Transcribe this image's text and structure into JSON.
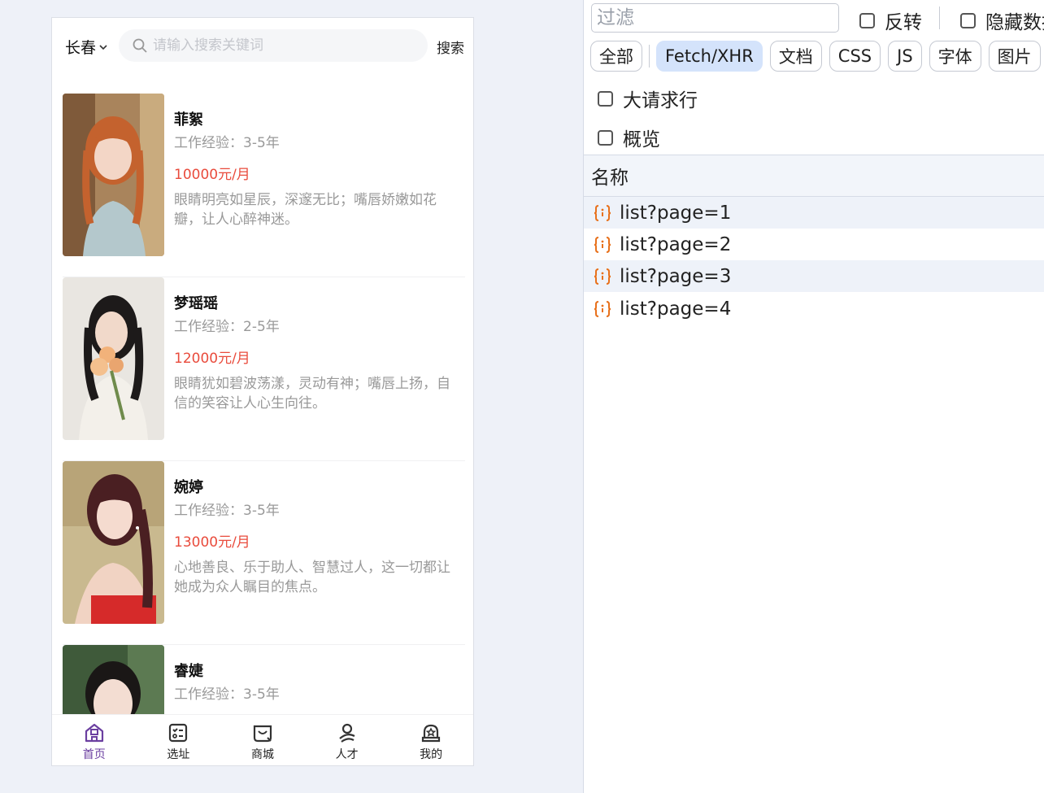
{
  "mobile": {
    "city": "长春",
    "search_placeholder": "请输入搜索关键词",
    "search_button": "搜索",
    "cards": [
      {
        "name": "菲絮",
        "experience": "工作经验：3-5年",
        "salary": "10000元/月",
        "desc": "眼睛明亮如星辰，深邃无比；嘴唇娇嫩如花瓣，让人心醉神迷。"
      },
      {
        "name": "梦瑶瑶",
        "experience": "工作经验：2-5年",
        "salary": "12000元/月",
        "desc": "眼睛犹如碧波荡漾，灵动有神；嘴唇上扬，自信的笑容让人心生向往。"
      },
      {
        "name": "婉婷",
        "experience": "工作经验：3-5年",
        "salary": "13000元/月",
        "desc": "心地善良、乐于助人、智慧过人，这一切都让她成为众人瞩目的焦点。"
      },
      {
        "name": "睿婕",
        "experience": "工作经验：3-5年",
        "salary": "",
        "desc": ""
      }
    ],
    "tabs": [
      {
        "label": "首页",
        "icon": "home-icon",
        "active": true
      },
      {
        "label": "选址",
        "icon": "checklist-icon",
        "active": false
      },
      {
        "label": "商城",
        "icon": "shop-bag-icon",
        "active": false
      },
      {
        "label": "人才",
        "icon": "talent-icon",
        "active": false
      },
      {
        "label": "我的",
        "icon": "profile-icon",
        "active": false
      }
    ],
    "accent_color": "#6b3fa0",
    "salary_color": "#e94b3c"
  },
  "devtools": {
    "filter_placeholder": "过滤",
    "invert_label": "反转",
    "hide_data_label": "隐藏数据",
    "chips": [
      "全部",
      "Fetch/XHR",
      "文档",
      "CSS",
      "JS",
      "字体",
      "图片"
    ],
    "active_chip": "Fetch/XHR",
    "big_rows_label": "大请求行",
    "overview_label": "概览",
    "name_column": "名称",
    "requests": [
      "list?page=1",
      "list?page=2",
      "list?page=3",
      "list?page=4"
    ],
    "request_icon": "fetch-braces-icon",
    "icon_color": "#e8711c"
  }
}
